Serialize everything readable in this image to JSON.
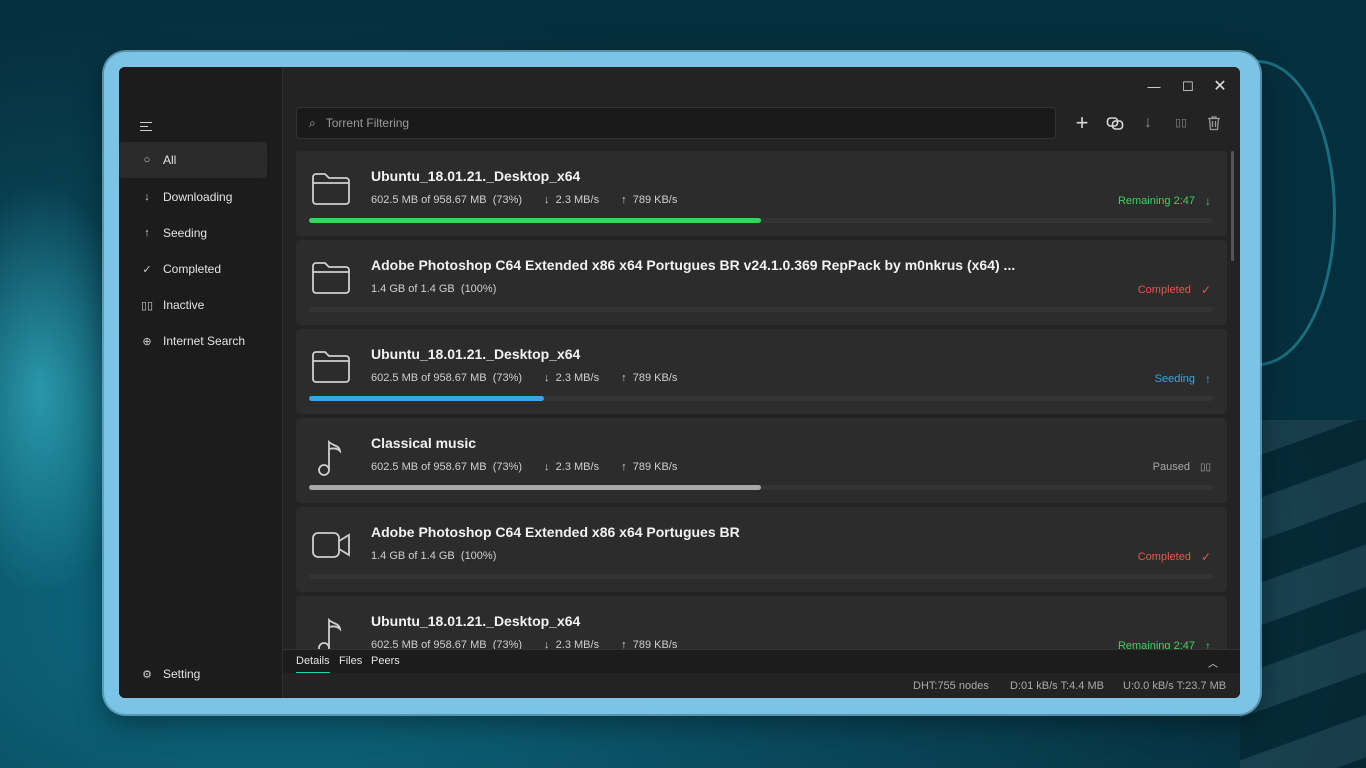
{
  "window": {
    "minimize_icon": "minimize-icon",
    "maximize_icon": "maximize-icon",
    "close_icon": "close-icon"
  },
  "sidebar": {
    "menu_icon": "menu-icon",
    "items": [
      {
        "label": "All",
        "icon": "circle-icon"
      },
      {
        "label": "Downloading",
        "icon": "arrow-down-icon"
      },
      {
        "label": "Seeding",
        "icon": "arrow-up-icon"
      },
      {
        "label": "Completed",
        "icon": "check-icon"
      },
      {
        "label": "Inactive",
        "icon": "pause-icon"
      },
      {
        "label": "Internet Search",
        "icon": "globe-icon"
      }
    ],
    "setting_label": "Setting"
  },
  "search": {
    "placeholder": "Torrent Filtering"
  },
  "toolbar": [
    "add-icon",
    "link-icon",
    "download-icon",
    "pause-icon",
    "trash-icon"
  ],
  "colors": {
    "green": "#3fd15d",
    "red": "#e6574a",
    "blue": "#3ba3e6",
    "gray": "#a8a8a8"
  },
  "torrents": [
    {
      "title": "Ubuntu_18.01.21._Desktop_x64",
      "size": "602.5 MB of 958.67 MB",
      "percent": "(73%)",
      "down": "2.3 MB/s",
      "up": "789 KB/s",
      "status": "Remaining 2:47",
      "status_icon": "arrow-down-icon",
      "progress": 0.5,
      "type": "folder-icon"
    },
    {
      "title": "Adobe Photoshop C64 Extended x86 x64 Portugues BR v24.1.0.369 RepPack by m0nkrus (x64) ...",
      "size": "1.4 GB of 1.4 GB",
      "percent": "(100%)",
      "down": "",
      "up": "",
      "status": "Completed",
      "status_icon": "check-icon",
      "progress": 1.0,
      "type": "folder-icon"
    },
    {
      "title": "Ubuntu_18.01.21._Desktop_x64",
      "size": "602.5 MB of 958.67 MB",
      "percent": "(73%)",
      "down": "2.3 MB/s",
      "up": "789 KB/s",
      "status": "Seeding",
      "status_icon": "arrow-up-icon",
      "progress": 0.26,
      "type": "folder-icon"
    },
    {
      "title": "Classical music",
      "size": "602.5 MB of 958.67 MB",
      "percent": "(73%)",
      "down": "2.3 MB/s",
      "up": "789 KB/s",
      "status": "Paused",
      "status_icon": "pause-icon",
      "progress": 0.5,
      "type": "music-icon"
    },
    {
      "title": "Adobe Photoshop C64 Extended x86 x64 Portugues BR",
      "size": "1.4 GB of 1.4 GB",
      "percent": "(100%)",
      "down": "",
      "up": "",
      "status": "Completed",
      "status_icon": "check-icon",
      "progress": 1.0,
      "type": "video-icon"
    },
    {
      "title": "Ubuntu_18.01.21._Desktop_x64",
      "size": "602.5 MB of 958.67 MB",
      "percent": "(73%)",
      "down": "2.3 MB/s",
      "up": "789 KB/s",
      "status": "Remaining 2:47",
      "status_icon": "arrow-up-icon",
      "progress": 0.5,
      "type": "music-icon"
    }
  ],
  "bottom_tabs": [
    "Details",
    "Files",
    "Peers"
  ],
  "statusbar": {
    "dht": "DHT:755 nodes",
    "download": "D:01 kB/s T:4.4 MB",
    "upload": "U:0.0 kB/s T:23.7 MB"
  }
}
